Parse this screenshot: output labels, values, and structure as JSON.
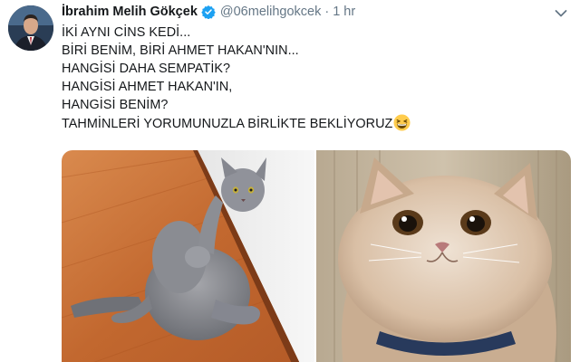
{
  "tweet": {
    "author": {
      "name": "İbrahim Melih Gökçek",
      "handle": "@06melihgokcek",
      "verified": true,
      "avatar_icon": "profile-photo"
    },
    "separator": "·",
    "time": "1 hr",
    "menu_icon": "chevron-down-icon",
    "text_lines": [
      "İKİ AYNI CİNS KEDİ...",
      "BİRİ BENİM, BİRİ AHMET HAKAN'NIN...",
      "HANGİSİ DAHA SEMPATİK?",
      "HANGİSİ AHMET HAKAN'IN,",
      "HANGİSİ BENİM?",
      "TAHMİNLERİ YORUMUNUZLA BİRLİKTE BEKLİYORUZ"
    ],
    "emoji": "grinning-squinting-face",
    "media": [
      {
        "icon": "cat-photo-left"
      },
      {
        "icon": "cat-photo-right"
      }
    ]
  },
  "colors": {
    "text": "#14171a",
    "secondary": "#657786",
    "verified": "#1da1f2"
  }
}
